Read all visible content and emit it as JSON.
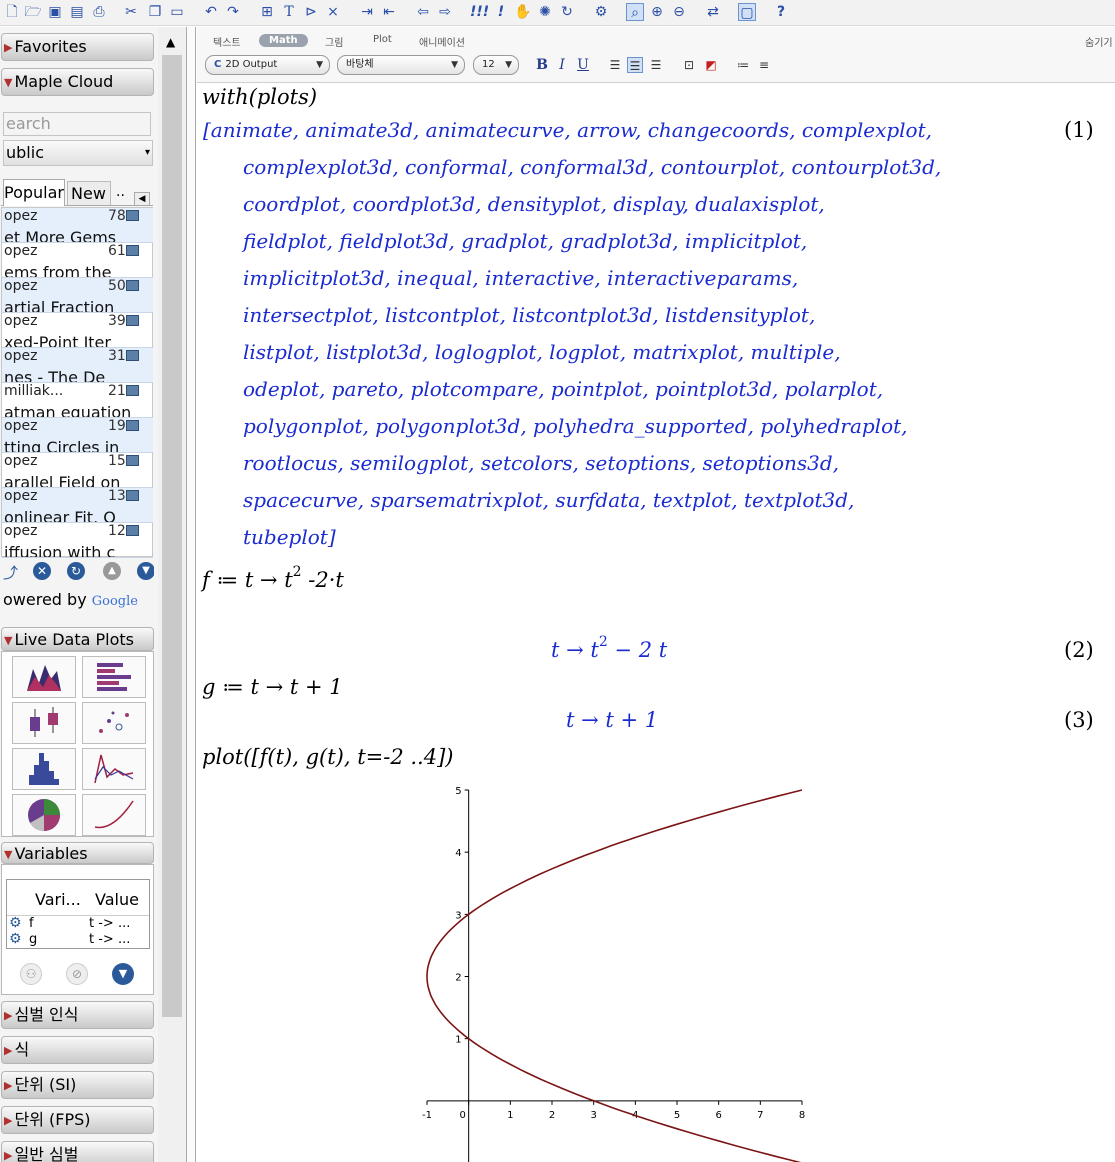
{
  "toolbar": {
    "icons": [
      "new-document",
      "open-folder",
      "save",
      "save-as",
      "print",
      "cut",
      "copy",
      "paste",
      "undo",
      "redo",
      "insert-table",
      "text-mode",
      "prompt",
      "clear-output",
      "indent",
      "outdent",
      "back",
      "forward",
      "execute-all",
      "execute",
      "stop",
      "debug",
      "restart",
      "settings",
      "zoom-100",
      "zoom-in",
      "zoom-out",
      "resize",
      "maximize",
      "help"
    ]
  },
  "sidebar": {
    "favorites_label": "Favorites",
    "cloud_label": "Maple Cloud",
    "search_placeholder": "earch",
    "group_value": "ublic",
    "tabs": [
      "Popular",
      "New",
      ".."
    ],
    "items": [
      {
        "author": "opez",
        "count": "78",
        "title": "et More Gems"
      },
      {
        "author": "opez",
        "count": "61",
        "title": "ems from the"
      },
      {
        "author": "opez",
        "count": "50",
        "title": "artial Fraction"
      },
      {
        "author": "opez",
        "count": "39",
        "title": "xed-Point Iter"
      },
      {
        "author": "opez",
        "count": "31",
        "title": "nes - The De"
      },
      {
        "author": "milliak...",
        "count": "21",
        "title": "atman equation"
      },
      {
        "author": "opez",
        "count": "19",
        "title": "tting Circles in"
      },
      {
        "author": "opez",
        "count": "15",
        "title": "arallel Field on"
      },
      {
        "author": "opez",
        "count": "13",
        "title": "onlinear Fit, O"
      },
      {
        "author": "opez",
        "count": "12",
        "title": "iffusion with c"
      }
    ],
    "powered_text": "owered by",
    "google_text": "Google",
    "live_data_label": "Live Data Plots",
    "variables_label": "Variables",
    "var_columns": [
      "Vari...",
      "Value"
    ],
    "variables": [
      {
        "name": "f",
        "value": "t -> ..."
      },
      {
        "name": "g",
        "value": "t -> ..."
      }
    ],
    "sections": [
      "심벌 인식",
      "식",
      "단위 (SI)",
      "단위 (FPS)",
      "일반 심벌"
    ]
  },
  "format_bar": {
    "modes": [
      "텍스트",
      "Math",
      "그림",
      "Plot",
      "애니메이션"
    ],
    "active_mode": "Math",
    "right_label": "숨기기",
    "style_value": "2D Output",
    "font_value": "바탕체",
    "size_value": "12",
    "bold": "B",
    "italic": "I",
    "underline": "U"
  },
  "document": {
    "cmd1": "with(plots)",
    "out1_lines": [
      "[animate, animate3d, animatecurve, arrow, changecoords, complexplot,",
      "complexplot3d, conformal, conformal3d, contourplot, contourplot3d,",
      "coordplot, coordplot3d, densityplot, display, dualaxisplot,",
      "fieldplot, fieldplot3d, gradplot, gradplot3d, implicitplot,",
      "implicitplot3d, inequal, interactive, interactiveparams,",
      "intersectplot, listcontplot, listcontplot3d, listdensityplot,",
      "listplot, listplot3d, loglogplot, logplot, matrixplot, multiple,",
      "odeplot, pareto, plotcompare, pointplot, pointplot3d, polarplot,",
      "polygonplot, polygonplot3d, polyhedra_supported, polyhedraplot,",
      "rootlocus, semilogplot, setcolors, setoptions, setoptions3d,",
      "spacecurve, sparsematrixplot, surfdata, textplot, textplot3d,",
      "tubeplot]"
    ],
    "label1": "(1)",
    "cmd2_lhs": "f ≔ t → t",
    "cmd2_exp": "2",
    "cmd2_rest": " -2·t",
    "out2_lhs": "t → t",
    "out2_exp": "2",
    "out2_rest": " − 2  t",
    "label2": "(2)",
    "cmd3": "g ≔ t → t + 1",
    "out3": "t → t + 1",
    "label3": "(3)",
    "cmd4": "plot([f(t), g(t), t=-2 ..4])"
  },
  "chart_data": {
    "type": "line",
    "parametric": true,
    "x_expr": "t^2 - 2t",
    "y_expr": "t + 1",
    "t_range": [
      -2,
      4
    ],
    "x": [
      8,
      5.25,
      3,
      1.25,
      0,
      -0.75,
      -1,
      -0.75,
      0,
      1.25,
      3,
      5.25,
      8
    ],
    "y": [
      -1,
      -0.5,
      0,
      0.5,
      1,
      1.5,
      2,
      2.5,
      3,
      3.5,
      4,
      4.5,
      5
    ],
    "xlim": [
      -1,
      8
    ],
    "ylim": [
      -1,
      5
    ],
    "xticks": [
      "-1",
      "0",
      "1",
      "2",
      "3",
      "4",
      "5",
      "6",
      "7",
      "8"
    ],
    "yticks": [
      "1",
      "2",
      "3",
      "4",
      "5"
    ],
    "line_color": "#7b1414",
    "grid": false
  }
}
